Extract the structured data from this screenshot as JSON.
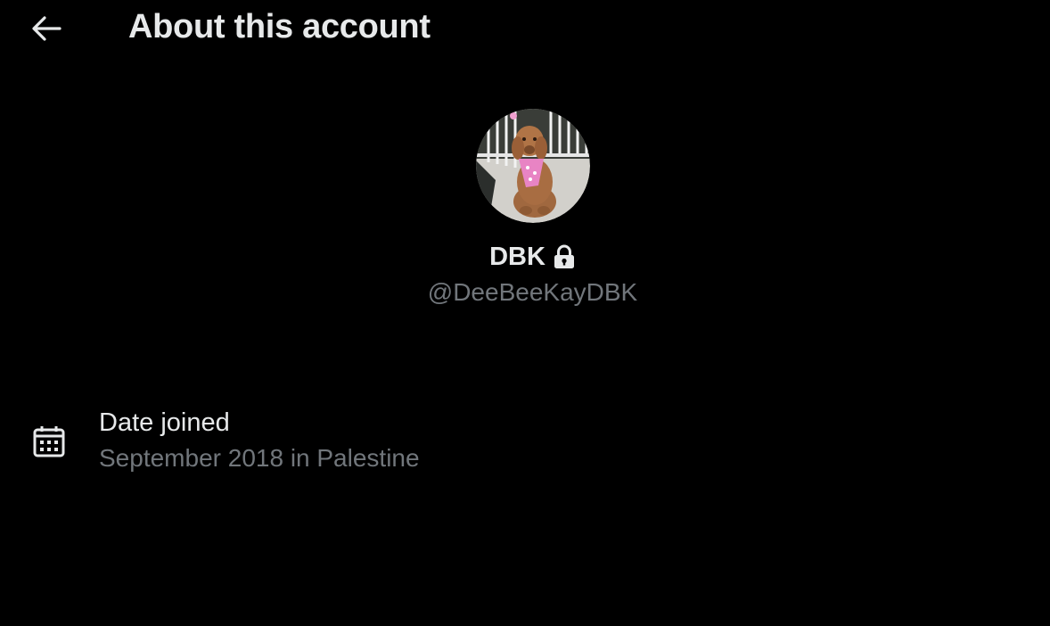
{
  "header": {
    "back_icon": "arrow-left-icon",
    "title": "About this account"
  },
  "profile": {
    "avatar_icon": "profile-avatar-dog",
    "display_name": "DBK",
    "protected_icon": "lock-icon",
    "handle": "@DeeBeeKayDBK"
  },
  "details": [
    {
      "icon": "calendar-icon",
      "label": "Date joined",
      "value": "September 2018 in Palestine"
    }
  ],
  "colors": {
    "background": "#000000",
    "primary_text": "#e7e9ea",
    "secondary_text": "#71767b"
  }
}
